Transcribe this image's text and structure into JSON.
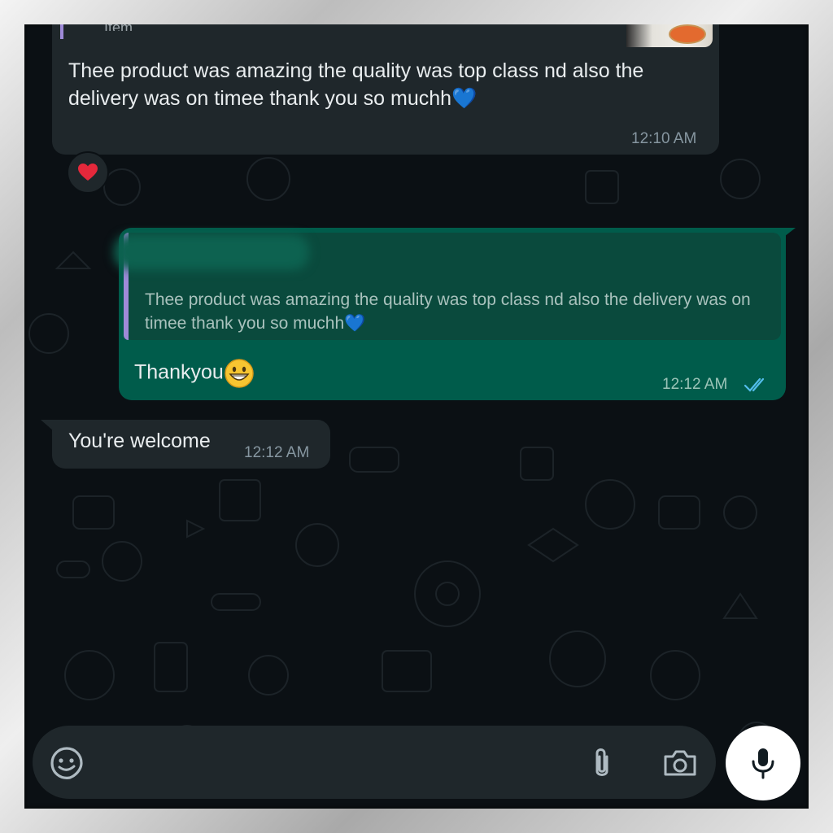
{
  "chat": {
    "incoming_top": {
      "quoted_label": "Item",
      "text": "Thee product was amazing the quality was top class nd also the delivery was on timee thank you so muchh💙",
      "time": "12:10 AM",
      "reaction": "heart-reaction"
    },
    "outgoing": {
      "quoted_text": "Thee product was amazing the quality was top class nd also the delivery was on timee thank you so muchh💙",
      "text": "Thankyou",
      "time": "12:12 AM",
      "status": "read-double-tick"
    },
    "incoming_reply": {
      "text": "You're welcome",
      "time": "12:12 AM"
    }
  },
  "composer": {
    "placeholder": "",
    "icons": [
      "sticker-icon",
      "attach-icon",
      "camera-icon",
      "mic-icon"
    ]
  },
  "colors": {
    "background": "#0b1014",
    "incoming_bubble": "#1f272b",
    "outgoing_bubble": "#005c4b",
    "tick_blue": "#53bdeb",
    "quote_bar": "#9e8ad8"
  }
}
